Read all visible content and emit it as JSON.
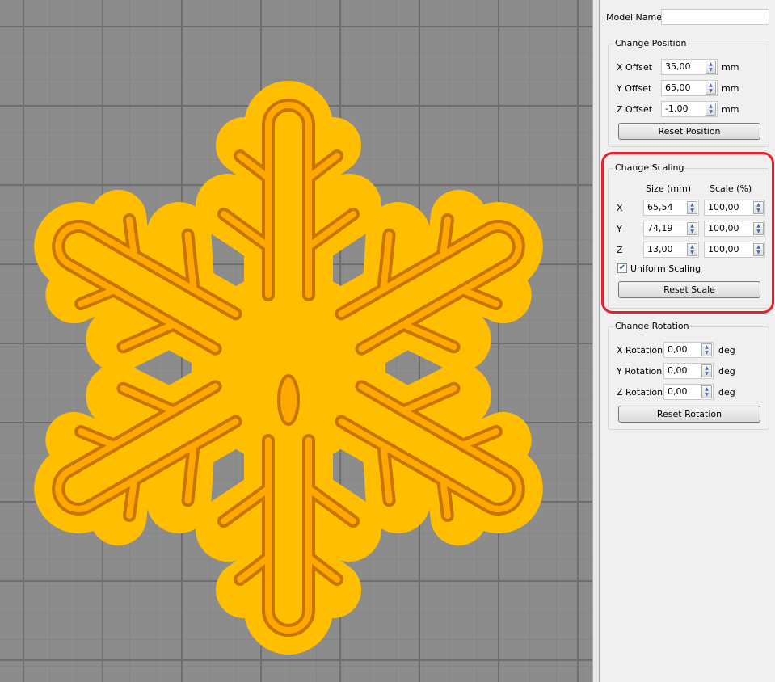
{
  "model_name": {
    "label": "Model Name:",
    "value": ""
  },
  "position": {
    "title": "Change Position",
    "rows": [
      {
        "label": "X Offset",
        "value": "35,00",
        "unit": "mm"
      },
      {
        "label": "Y Offset",
        "value": "65,00",
        "unit": "mm"
      },
      {
        "label": "Z Offset",
        "value": "-1,00",
        "unit": "mm"
      }
    ],
    "reset": "Reset Position"
  },
  "scaling": {
    "title": "Change Scaling",
    "size_header": "Size (mm)",
    "scale_header": "Scale (%)",
    "rows": [
      {
        "axis": "X",
        "size": "65,54",
        "scale": "100,00"
      },
      {
        "axis": "Y",
        "size": "74,19",
        "scale": "100,00"
      },
      {
        "axis": "Z",
        "size": "13,00",
        "scale": "100,00"
      }
    ],
    "uniform": "Uniform Scaling",
    "uniform_checked": true,
    "reset": "Reset Scale"
  },
  "rotation": {
    "title": "Change Rotation",
    "rows": [
      {
        "label": "X Rotation",
        "value": "0,00",
        "unit": "deg"
      },
      {
        "label": "Y Rotation",
        "value": "0,00",
        "unit": "deg"
      },
      {
        "label": "Z Rotation",
        "value": "0,00",
        "unit": "deg"
      }
    ],
    "reset": "Reset Rotation"
  },
  "colors": {
    "model": "#ffbf00",
    "wall": "#e08a00",
    "highlight": "#e8202a"
  }
}
